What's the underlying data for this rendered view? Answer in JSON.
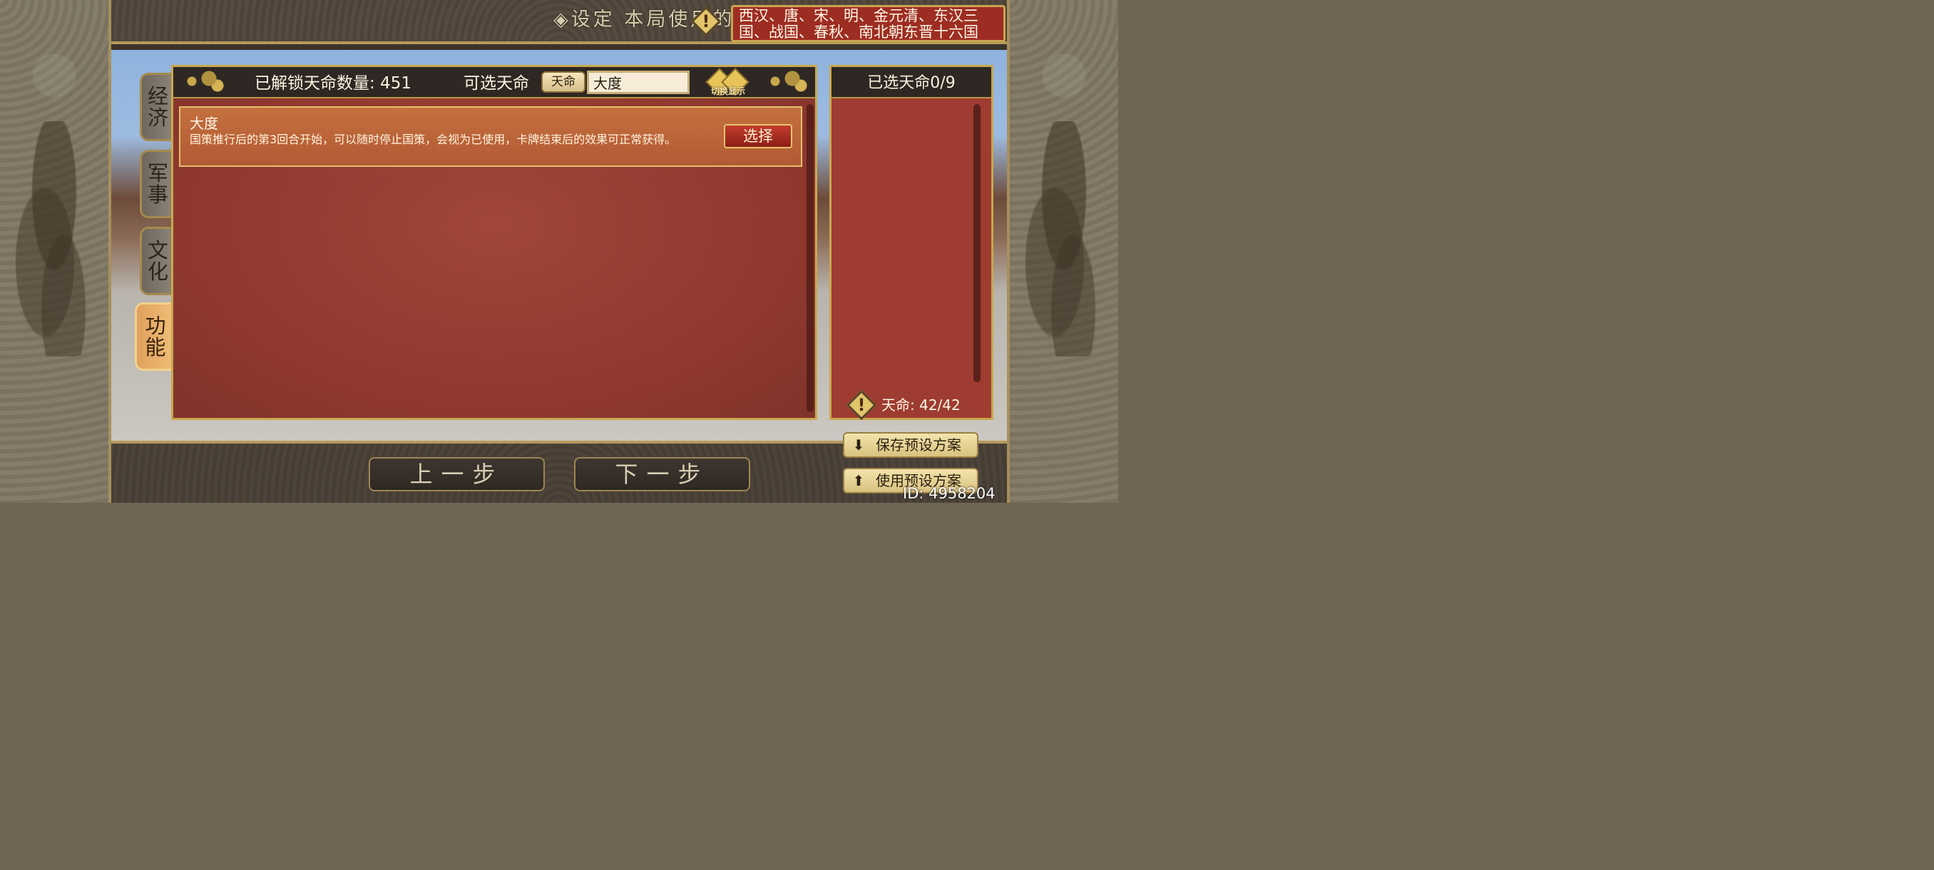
{
  "header": {
    "title": "设定 本局使用的天命",
    "dynasties": "西汉、唐、宋、明、金元清、东汉三国、战国、春秋、南北朝东晋十六国"
  },
  "tabs": [
    {
      "label": "经济",
      "active": false
    },
    {
      "label": "军事",
      "active": false
    },
    {
      "label": "文化",
      "active": false
    },
    {
      "label": "功能",
      "active": true
    }
  ],
  "list": {
    "unlocked_label": "已解锁天命数量: 451",
    "selectable_label": "可选天命",
    "filter_tag": "天命",
    "search_value": "大度",
    "switch_label": "切换显示",
    "items": [
      {
        "title": "大度",
        "description": "国策推行后的第3回合开始，可以随时停止国策，会视为已使用，卡牌结束后的效果可正常获得。",
        "button": "选择"
      }
    ]
  },
  "selected": {
    "header": "已选天命0/9",
    "count": "天命: 42/42"
  },
  "nav": {
    "prev": "上一步",
    "next": "下一步"
  },
  "presets": {
    "save": "保存预设方案",
    "use": "使用预设方案"
  },
  "footer": {
    "id": "ID: 4958204"
  }
}
